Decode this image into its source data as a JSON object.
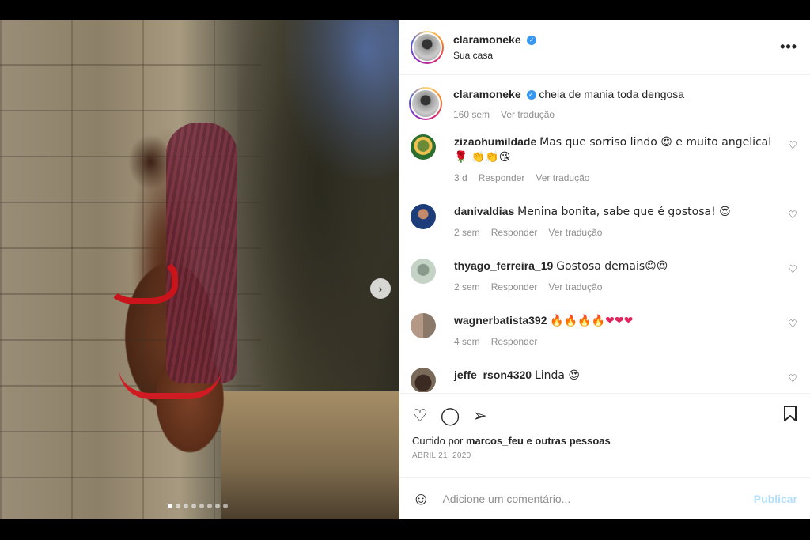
{
  "post": {
    "username": "claramoneke",
    "location": "Sua casa",
    "caption": "cheia de mania toda dengosa",
    "caption_time": "160 sem",
    "caption_translate": "Ver tradução",
    "verified_icon": "verified-badge"
  },
  "comments": [
    {
      "user": "zizaohumildade",
      "text": "Mas que sorriso lindo 😍 e muito angelical 🌹 👏👏😘",
      "time": "3 d",
      "reply": "Responder",
      "translate": "Ver tradução"
    },
    {
      "user": "danivaldias",
      "text": "Menina bonita, sabe que é gostosa! 😍",
      "time": "2 sem",
      "reply": "Responder",
      "translate": "Ver tradução"
    },
    {
      "user": "thyago_ferreira_19",
      "text": "Gostosa demais😊😍",
      "time": "2 sem",
      "reply": "Responder",
      "translate": "Ver tradução"
    },
    {
      "user": "wagnerbatista392",
      "text": "🔥🔥🔥🔥❤❤❤",
      "time": "4 sem",
      "reply": "Responder"
    },
    {
      "user": "jeffe_rson4320",
      "text": "Linda 😍"
    }
  ],
  "likes": {
    "prefix": "Curtido por",
    "user": "marcos_feu",
    "suffix": "e outras pessoas"
  },
  "date": "ABRIL 21, 2020",
  "add_comment": {
    "placeholder": "Adicione um comentário...",
    "post_label": "Publicar"
  },
  "icons": {
    "more": "more-horizontal-icon",
    "heart": "heart-icon",
    "comment": "comment-icon",
    "share": "share-icon",
    "save": "bookmark-icon",
    "emoji": "emoji-icon",
    "next": "chevron-right-icon"
  },
  "carousel": {
    "count": 8,
    "active_index": 0
  }
}
